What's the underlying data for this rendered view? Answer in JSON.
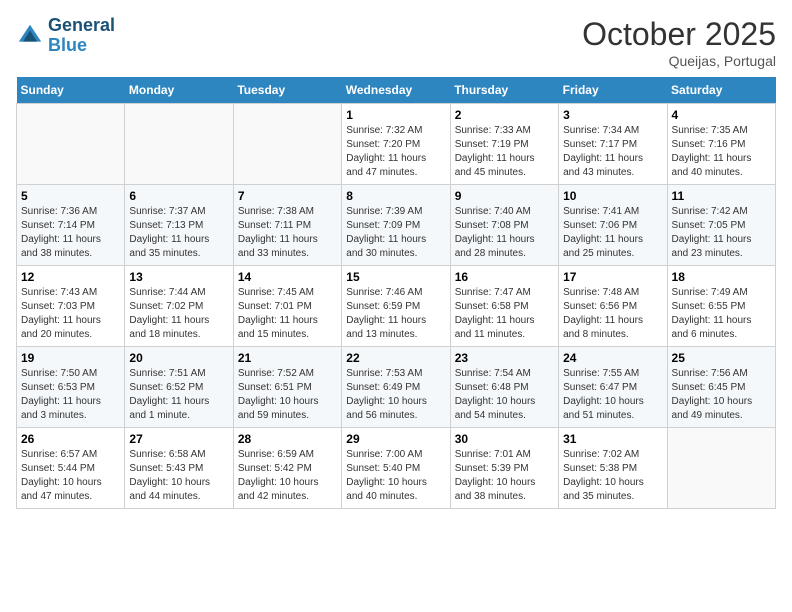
{
  "header": {
    "logo_line1": "General",
    "logo_line2": "Blue",
    "month_title": "October 2025",
    "location": "Queijas, Portugal"
  },
  "days_of_week": [
    "Sunday",
    "Monday",
    "Tuesday",
    "Wednesday",
    "Thursday",
    "Friday",
    "Saturday"
  ],
  "weeks": [
    [
      {
        "day": "",
        "info": ""
      },
      {
        "day": "",
        "info": ""
      },
      {
        "day": "",
        "info": ""
      },
      {
        "day": "1",
        "info": "Sunrise: 7:32 AM\nSunset: 7:20 PM\nDaylight: 11 hours\nand 47 minutes."
      },
      {
        "day": "2",
        "info": "Sunrise: 7:33 AM\nSunset: 7:19 PM\nDaylight: 11 hours\nand 45 minutes."
      },
      {
        "day": "3",
        "info": "Sunrise: 7:34 AM\nSunset: 7:17 PM\nDaylight: 11 hours\nand 43 minutes."
      },
      {
        "day": "4",
        "info": "Sunrise: 7:35 AM\nSunset: 7:16 PM\nDaylight: 11 hours\nand 40 minutes."
      }
    ],
    [
      {
        "day": "5",
        "info": "Sunrise: 7:36 AM\nSunset: 7:14 PM\nDaylight: 11 hours\nand 38 minutes."
      },
      {
        "day": "6",
        "info": "Sunrise: 7:37 AM\nSunset: 7:13 PM\nDaylight: 11 hours\nand 35 minutes."
      },
      {
        "day": "7",
        "info": "Sunrise: 7:38 AM\nSunset: 7:11 PM\nDaylight: 11 hours\nand 33 minutes."
      },
      {
        "day": "8",
        "info": "Sunrise: 7:39 AM\nSunset: 7:09 PM\nDaylight: 11 hours\nand 30 minutes."
      },
      {
        "day": "9",
        "info": "Sunrise: 7:40 AM\nSunset: 7:08 PM\nDaylight: 11 hours\nand 28 minutes."
      },
      {
        "day": "10",
        "info": "Sunrise: 7:41 AM\nSunset: 7:06 PM\nDaylight: 11 hours\nand 25 minutes."
      },
      {
        "day": "11",
        "info": "Sunrise: 7:42 AM\nSunset: 7:05 PM\nDaylight: 11 hours\nand 23 minutes."
      }
    ],
    [
      {
        "day": "12",
        "info": "Sunrise: 7:43 AM\nSunset: 7:03 PM\nDaylight: 11 hours\nand 20 minutes."
      },
      {
        "day": "13",
        "info": "Sunrise: 7:44 AM\nSunset: 7:02 PM\nDaylight: 11 hours\nand 18 minutes."
      },
      {
        "day": "14",
        "info": "Sunrise: 7:45 AM\nSunset: 7:01 PM\nDaylight: 11 hours\nand 15 minutes."
      },
      {
        "day": "15",
        "info": "Sunrise: 7:46 AM\nSunset: 6:59 PM\nDaylight: 11 hours\nand 13 minutes."
      },
      {
        "day": "16",
        "info": "Sunrise: 7:47 AM\nSunset: 6:58 PM\nDaylight: 11 hours\nand 11 minutes."
      },
      {
        "day": "17",
        "info": "Sunrise: 7:48 AM\nSunset: 6:56 PM\nDaylight: 11 hours\nand 8 minutes."
      },
      {
        "day": "18",
        "info": "Sunrise: 7:49 AM\nSunset: 6:55 PM\nDaylight: 11 hours\nand 6 minutes."
      }
    ],
    [
      {
        "day": "19",
        "info": "Sunrise: 7:50 AM\nSunset: 6:53 PM\nDaylight: 11 hours\nand 3 minutes."
      },
      {
        "day": "20",
        "info": "Sunrise: 7:51 AM\nSunset: 6:52 PM\nDaylight: 11 hours\nand 1 minute."
      },
      {
        "day": "21",
        "info": "Sunrise: 7:52 AM\nSunset: 6:51 PM\nDaylight: 10 hours\nand 59 minutes."
      },
      {
        "day": "22",
        "info": "Sunrise: 7:53 AM\nSunset: 6:49 PM\nDaylight: 10 hours\nand 56 minutes."
      },
      {
        "day": "23",
        "info": "Sunrise: 7:54 AM\nSunset: 6:48 PM\nDaylight: 10 hours\nand 54 minutes."
      },
      {
        "day": "24",
        "info": "Sunrise: 7:55 AM\nSunset: 6:47 PM\nDaylight: 10 hours\nand 51 minutes."
      },
      {
        "day": "25",
        "info": "Sunrise: 7:56 AM\nSunset: 6:45 PM\nDaylight: 10 hours\nand 49 minutes."
      }
    ],
    [
      {
        "day": "26",
        "info": "Sunrise: 6:57 AM\nSunset: 5:44 PM\nDaylight: 10 hours\nand 47 minutes."
      },
      {
        "day": "27",
        "info": "Sunrise: 6:58 AM\nSunset: 5:43 PM\nDaylight: 10 hours\nand 44 minutes."
      },
      {
        "day": "28",
        "info": "Sunrise: 6:59 AM\nSunset: 5:42 PM\nDaylight: 10 hours\nand 42 minutes."
      },
      {
        "day": "29",
        "info": "Sunrise: 7:00 AM\nSunset: 5:40 PM\nDaylight: 10 hours\nand 40 minutes."
      },
      {
        "day": "30",
        "info": "Sunrise: 7:01 AM\nSunset: 5:39 PM\nDaylight: 10 hours\nand 38 minutes."
      },
      {
        "day": "31",
        "info": "Sunrise: 7:02 AM\nSunset: 5:38 PM\nDaylight: 10 hours\nand 35 minutes."
      },
      {
        "day": "",
        "info": ""
      }
    ]
  ]
}
